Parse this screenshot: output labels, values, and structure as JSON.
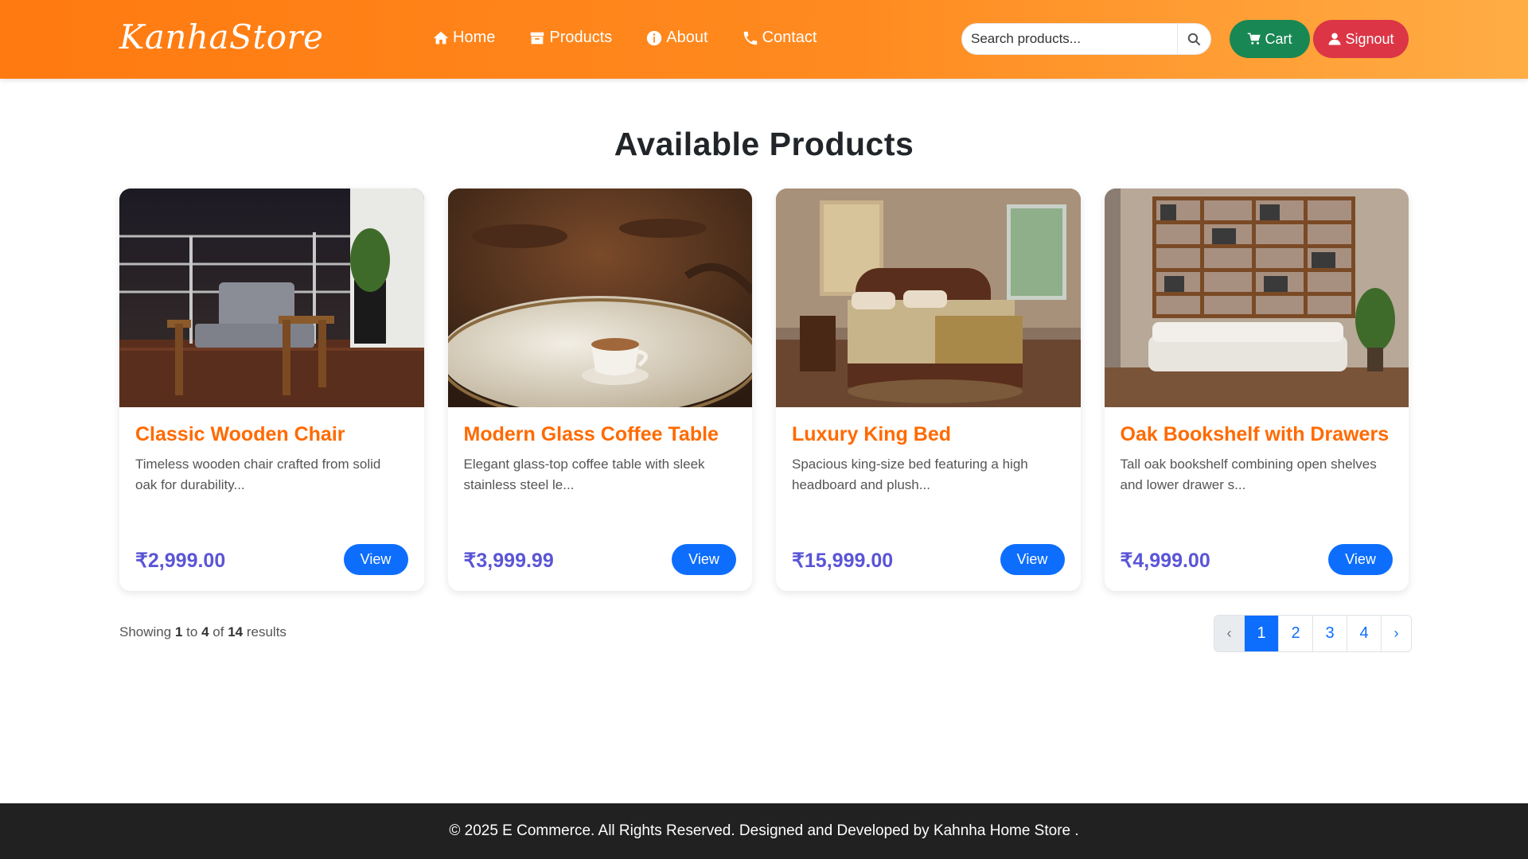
{
  "brand": "KanhaStore",
  "nav": {
    "home": "Home",
    "products": "Products",
    "about": "About",
    "contact": "Contact"
  },
  "search": {
    "placeholder": "Search products..."
  },
  "header_buttons": {
    "cart": "Cart",
    "signout": "Signout"
  },
  "page_title": "Available Products",
  "products": [
    {
      "title": "Classic Wooden Chair",
      "description": "Timeless wooden chair crafted from solid oak for durability...",
      "price": "₹2,999.00",
      "button": "View"
    },
    {
      "title": "Modern Glass Coffee Table",
      "description": "Elegant glass-top coffee table with sleek stainless steel le...",
      "price": "₹3,999.99",
      "button": "View"
    },
    {
      "title": "Luxury King Bed",
      "description": "Spacious king-size bed featuring a high headboard and plush...",
      "price": "₹15,999.00",
      "button": "View"
    },
    {
      "title": "Oak Bookshelf with Drawers",
      "description": "Tall oak bookshelf combining open shelves and lower drawer s...",
      "price": "₹4,999.00",
      "button": "View"
    }
  ],
  "results": {
    "prefix": "Showing",
    "from": "1",
    "to_word": "to",
    "to": "4",
    "of_word": "of",
    "total": "14",
    "suffix": "results"
  },
  "pagination": {
    "prev": "‹",
    "pages": [
      "1",
      "2",
      "3",
      "4"
    ],
    "active": "1",
    "next": "›"
  },
  "footer": "© 2025 E Commerce. All Rights Reserved. Designed and Developed by Kahnha Home Store .",
  "colors": {
    "header_start": "#ff7a10",
    "header_end": "#ffad45",
    "cart": "#198754",
    "signout": "#dc3545",
    "primary": "#0d6efd",
    "title_orange": "#ff6a00",
    "price": "#5a55d6",
    "footer": "#212121"
  }
}
